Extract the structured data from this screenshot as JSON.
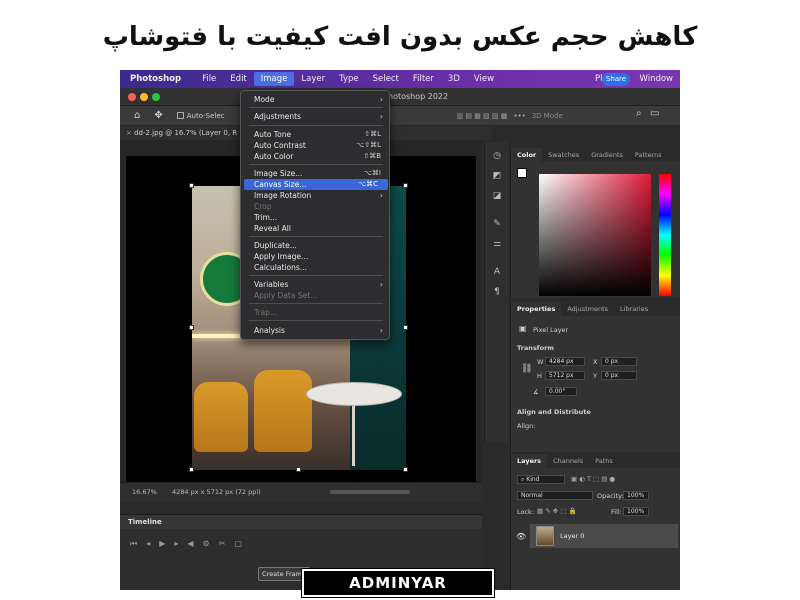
{
  "headline": "کاهش حجم عکس بدون افت کیفیت با فتوشاپ",
  "brand": "ADMINYAR",
  "menubar": {
    "app": "Photoshop",
    "items": [
      "File",
      "Edit",
      "Image",
      "Layer",
      "Type",
      "Select",
      "Filter",
      "3D",
      "View"
    ],
    "active": "Image",
    "right_items": [
      "Plugins",
      "Window"
    ]
  },
  "window": {
    "title": "hotoshop 2022"
  },
  "optionsbar": {
    "auto_select": "Auto-Selec",
    "mode_3d": "3D Mode",
    "share": "Share"
  },
  "document": {
    "tab": "dd-2.jpg @ 16.7% (Layer 0, R",
    "zoom": "16.67%",
    "info": "4284 px x 5712 px (72 ppi)"
  },
  "image_menu": {
    "items": [
      {
        "label": "Mode",
        "submenu": true
      },
      {
        "label": "Adjustments",
        "submenu": true
      },
      {
        "label": "Auto Tone",
        "shortcut": "⇧⌘L"
      },
      {
        "label": "Auto Contrast",
        "shortcut": "⌥⇧⌘L"
      },
      {
        "label": "Auto Color",
        "shortcut": "⇧⌘B"
      },
      {
        "label": "Image Size...",
        "shortcut": "⌥⌘I"
      },
      {
        "label": "Canvas Size...",
        "shortcut": "⌥⌘C",
        "highlighted": true
      },
      {
        "label": "Image Rotation",
        "submenu": true
      },
      {
        "label": "Crop",
        "disabled": true
      },
      {
        "label": "Trim..."
      },
      {
        "label": "Reveal All"
      },
      {
        "label": "Duplicate..."
      },
      {
        "label": "Apply Image..."
      },
      {
        "label": "Calculations..."
      },
      {
        "label": "Variables",
        "submenu": true
      },
      {
        "label": "Apply Data Set...",
        "disabled": true
      },
      {
        "label": "Trap...",
        "disabled": true
      },
      {
        "label": "Analysis",
        "submenu": true
      }
    ]
  },
  "color_panel": {
    "tabs": [
      "Color",
      "Swatches",
      "Gradients",
      "Patterns"
    ],
    "active": "Color"
  },
  "properties_panel": {
    "tabs": [
      "Properties",
      "Adjustments",
      "Libraries"
    ],
    "active": "Properties",
    "layer_kind": "Pixel Layer",
    "transform_title": "Transform",
    "w_label": "W",
    "w_value": "4284 px",
    "h_label": "H",
    "h_value": "5712 px",
    "x_label": "X",
    "x_value": "0 px",
    "y_label": "Y",
    "y_value": "0 px",
    "angle_value": "0.00°",
    "align_title": "Align and Distribute",
    "align_label": "Align:"
  },
  "layers_panel": {
    "tabs": [
      "Layers",
      "Channels",
      "Paths"
    ],
    "active": "Layers",
    "kind": "Kind",
    "blend_mode": "Normal",
    "opacity_label": "Opacity:",
    "opacity": "100%",
    "lock_label": "Lock:",
    "fill_label": "Fill:",
    "fill": "100%",
    "layer_name": "Layer 0"
  },
  "timeline": {
    "title": "Timeline",
    "create_button": "Create Frame"
  },
  "colors": {
    "menubar": "#5b2ea0",
    "accent": "#3b66d6",
    "share": "#2f6fe6"
  }
}
